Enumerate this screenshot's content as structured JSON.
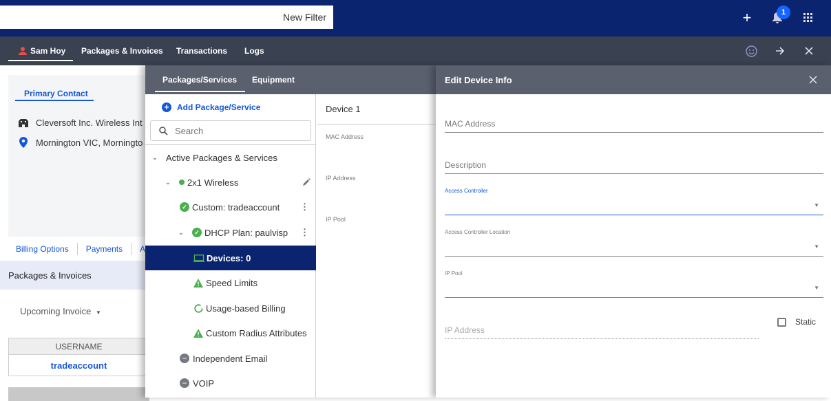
{
  "topbar": {
    "filter_label": "New Filter",
    "notification_count": "1",
    "icons": [
      "plus-icon",
      "bell-icon",
      "apps-grid-icon"
    ]
  },
  "navbar": {
    "tabs": [
      {
        "label": "Sam Hoy",
        "icon": "person-icon",
        "active": true
      },
      {
        "label": "Packages & Invoices"
      },
      {
        "label": "Transactions"
      },
      {
        "label": "Logs"
      }
    ],
    "icons": [
      "smiley-icon",
      "arrow-right-icon",
      "close-icon"
    ]
  },
  "left": {
    "contact_tab": "Primary Contact",
    "company": "Cleversoft Inc. Wireless Int",
    "address": "Mornington VIC, Morningto",
    "billing_links": [
      "Billing Options",
      "Payments",
      "A"
    ],
    "section_title": "Packages & Invoices",
    "upcoming_invoice": "Upcoming Invoice",
    "table": {
      "header": "USERNAME",
      "rows": [
        "tradeaccount"
      ]
    }
  },
  "middle": {
    "tabs": [
      {
        "label": "Packages/Services",
        "active": true
      },
      {
        "label": "Equipment"
      }
    ],
    "add_label": "Add Package/Service",
    "search_placeholder": "Search",
    "tree": [
      {
        "label": "Active Packages & Services",
        "level": 0,
        "expanded": true
      },
      {
        "label": "2x1 Wireless",
        "level": 1,
        "expanded": true,
        "status": "active-dot",
        "action": "edit"
      },
      {
        "label": "Custom: tradeaccount",
        "level": 2,
        "status": "check",
        "action": "more"
      },
      {
        "label": "DHCP Plan: paulvisp",
        "level": 2,
        "expanded": true,
        "status": "check",
        "action": "more"
      },
      {
        "label": "Devices: 0",
        "level": 3,
        "status": "laptop",
        "selected": true
      },
      {
        "label": "Speed Limits",
        "level": 3,
        "status": "warning"
      },
      {
        "label": "Usage-based Billing",
        "level": 3,
        "status": "progress"
      },
      {
        "label": "Custom Radius Attributes",
        "level": 3,
        "status": "warning"
      },
      {
        "label": "Independent Email",
        "level": 2,
        "status": "inactive"
      },
      {
        "label": "VOIP",
        "level": 2,
        "status": "inactive"
      }
    ],
    "device": {
      "title": "Device 1",
      "labels": [
        "MAC Address",
        "IP Address",
        "IP Pool"
      ]
    }
  },
  "edit_panel": {
    "title": "Edit Device Info",
    "fields": {
      "mac_address": {
        "label": "MAC Address",
        "value": ""
      },
      "description": {
        "label": "Description",
        "value": ""
      },
      "access_controller": {
        "label": "Access Controller",
        "value": "",
        "focused": true
      },
      "access_controller_location": {
        "label": "Access Controller Location",
        "value": ""
      },
      "ip_pool": {
        "label": "IP Pool",
        "value": ""
      },
      "ip_address": {
        "label": "IP Address",
        "value": "",
        "disabled": true
      }
    },
    "static_label": "Static",
    "static_checked": false
  },
  "colors": {
    "topbar": "#0b2470",
    "navbar": "#3a4150",
    "panel_header": "#5a606d",
    "accent_blue": "#1557d6",
    "status_green": "#4caf50"
  }
}
